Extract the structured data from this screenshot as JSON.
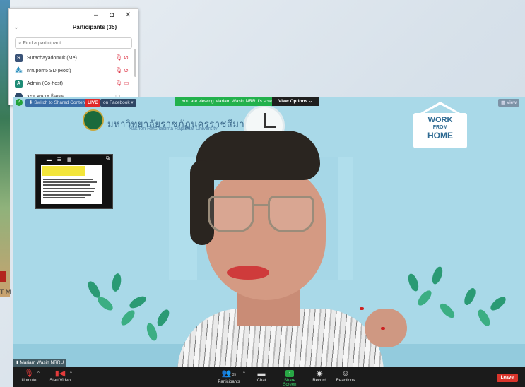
{
  "background": {
    "partial_text": "T M"
  },
  "participants_panel": {
    "title": "Participants (35)",
    "search_placeholder": "Find a participant",
    "participants": [
      {
        "initial": "S",
        "name": "Surachayadomuk (Me)"
      },
      {
        "initial": "",
        "name": "nrrupom5 SD (Host)"
      },
      {
        "initial": "A",
        "name": "Admin (Co-host)"
      },
      {
        "initial": "",
        "name": "ระพ.คนาฮ ธิฒตต"
      }
    ]
  },
  "meeting": {
    "switch_button": "Switch to Shared Content",
    "live_badge": "LIVE",
    "live_on": "on Facebook",
    "viewing_banner": "You are viewing Mariam Wasin NRRU's screen",
    "view_options": "View Options",
    "view_button": "View",
    "university_thai": "มหาวิทยาลัยราชภัฏนครราชสีมา",
    "university_en": "Nakhon Ratchasima Rajabhat University",
    "wfh_line1": "WORK",
    "wfh_line2": "FROM",
    "wfh_line3": "HOME",
    "speaker_name": "Mariam Wasin NRRU"
  },
  "toolbar": {
    "unmute": "Unmute",
    "start_video": "Start Video",
    "participants": "Participants",
    "participants_count": "35",
    "chat": "Chat",
    "share_screen": "Share Screen",
    "record": "Record",
    "reactions": "Reactions",
    "leave": "Leave"
  },
  "colors": {
    "zoom_toolbar": "#1b1b1b",
    "viewing_banner": "#22b14c",
    "leave": "#d9342b",
    "live": "#e02828"
  }
}
